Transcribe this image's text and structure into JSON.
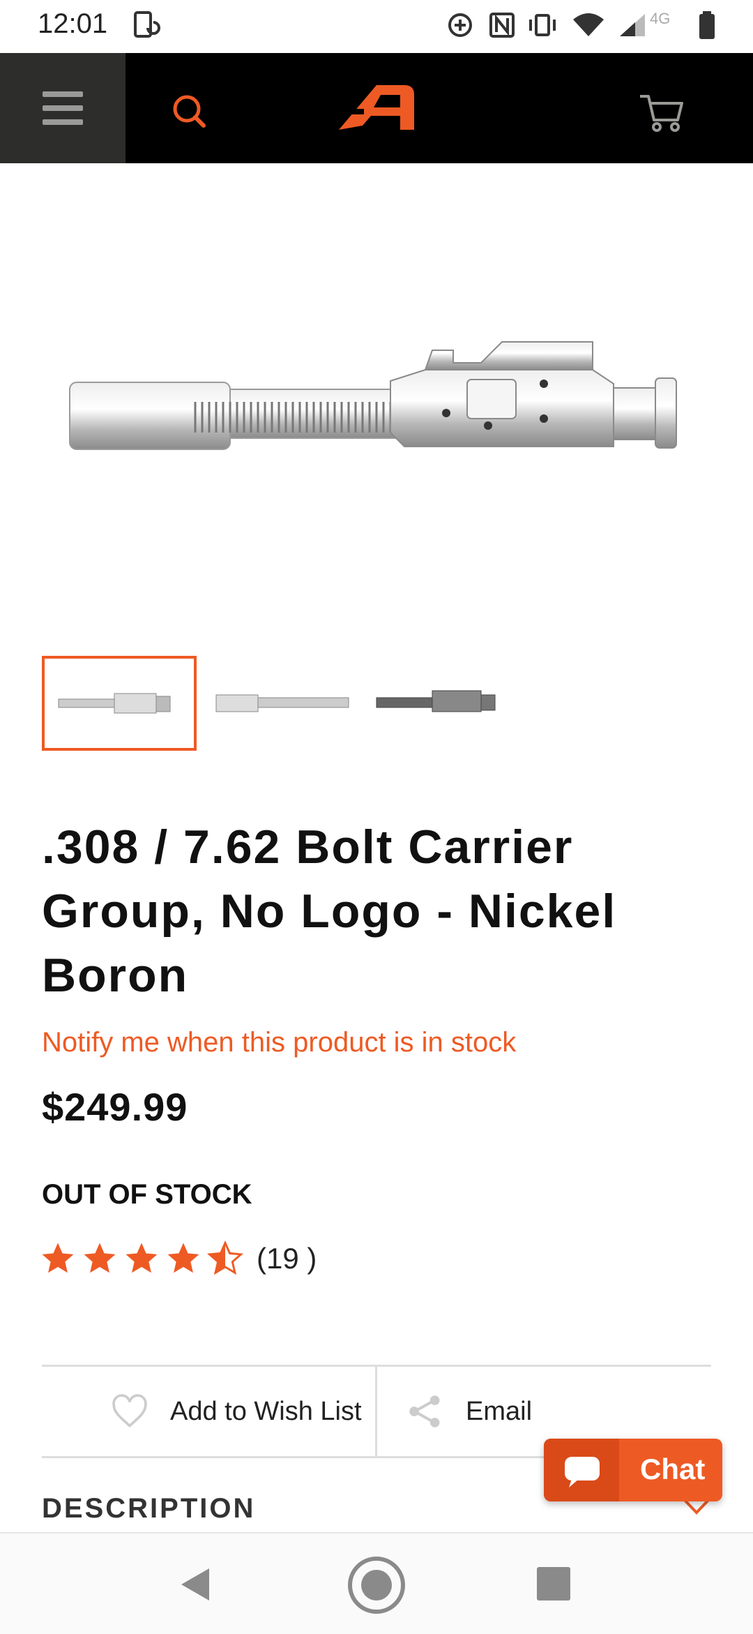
{
  "status_bar": {
    "time": "12:01",
    "network": "4G",
    "icons": [
      "screen-rotate-icon",
      "data-saver-icon",
      "nfc-icon",
      "vibrate-icon",
      "wifi-icon",
      "signal-icon",
      "battery-icon"
    ]
  },
  "header": {
    "menu_icon": "hamburger-menu-icon",
    "search_icon": "search-icon",
    "logo_icon": "brand-logo-icon",
    "cart_icon": "cart-icon"
  },
  "product": {
    "title": ".308 / 7.62 Bolt Carrier Group, No Logo - Nickel Boron",
    "notify_link": "Notify me when this product is in stock",
    "price": "$249.99",
    "stock_status": "OUT OF STOCK",
    "rating": 4.5,
    "review_count": "(19 )",
    "thumbnails": [
      "thumbnail-1",
      "thumbnail-2",
      "thumbnail-3"
    ]
  },
  "actions": {
    "wishlist_label": "Add to Wish List",
    "email_label": "Email"
  },
  "description": {
    "label": "DESCRIPTION"
  },
  "chat": {
    "label": "Chat"
  },
  "colors": {
    "accent": "#ee5a24",
    "header_bg": "#000000",
    "menu_bg": "#2d2d2b"
  }
}
